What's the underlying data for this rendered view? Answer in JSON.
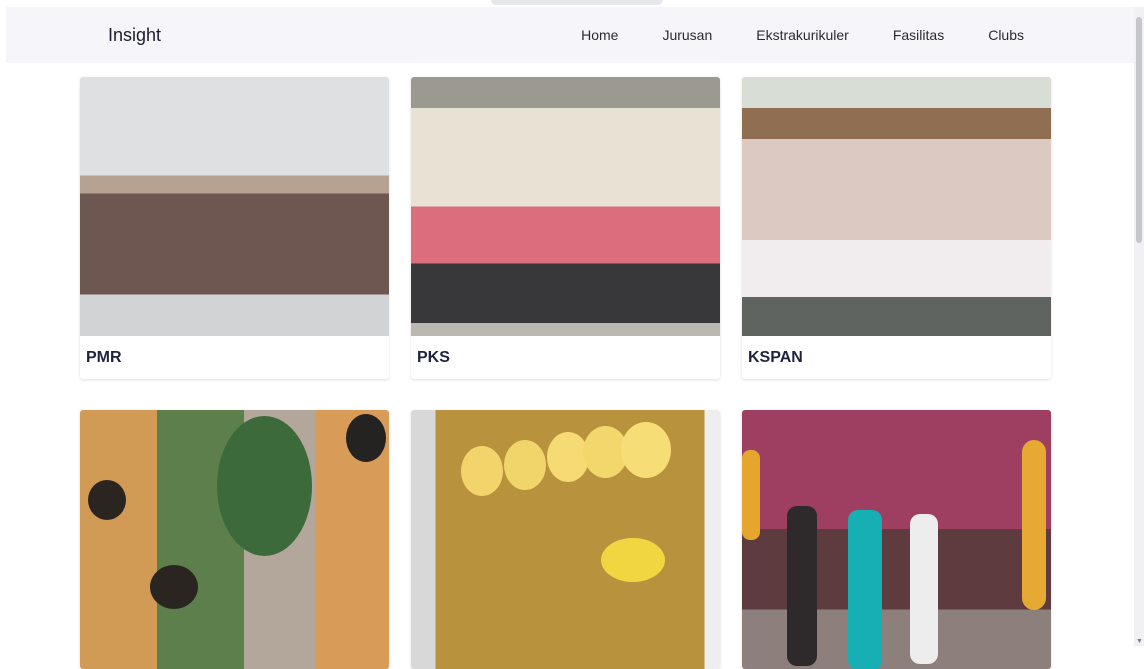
{
  "navbar": {
    "brand": "Insight",
    "links": [
      "Home",
      "Jurusan",
      "Ekstrakurikuler",
      "Fasilitas",
      "Clubs"
    ]
  },
  "cards": [
    {
      "title": "PMR"
    },
    {
      "title": "PKS"
    },
    {
      "title": "KSPAN"
    },
    {
      "title": ""
    },
    {
      "title": ""
    },
    {
      "title": ""
    }
  ]
}
